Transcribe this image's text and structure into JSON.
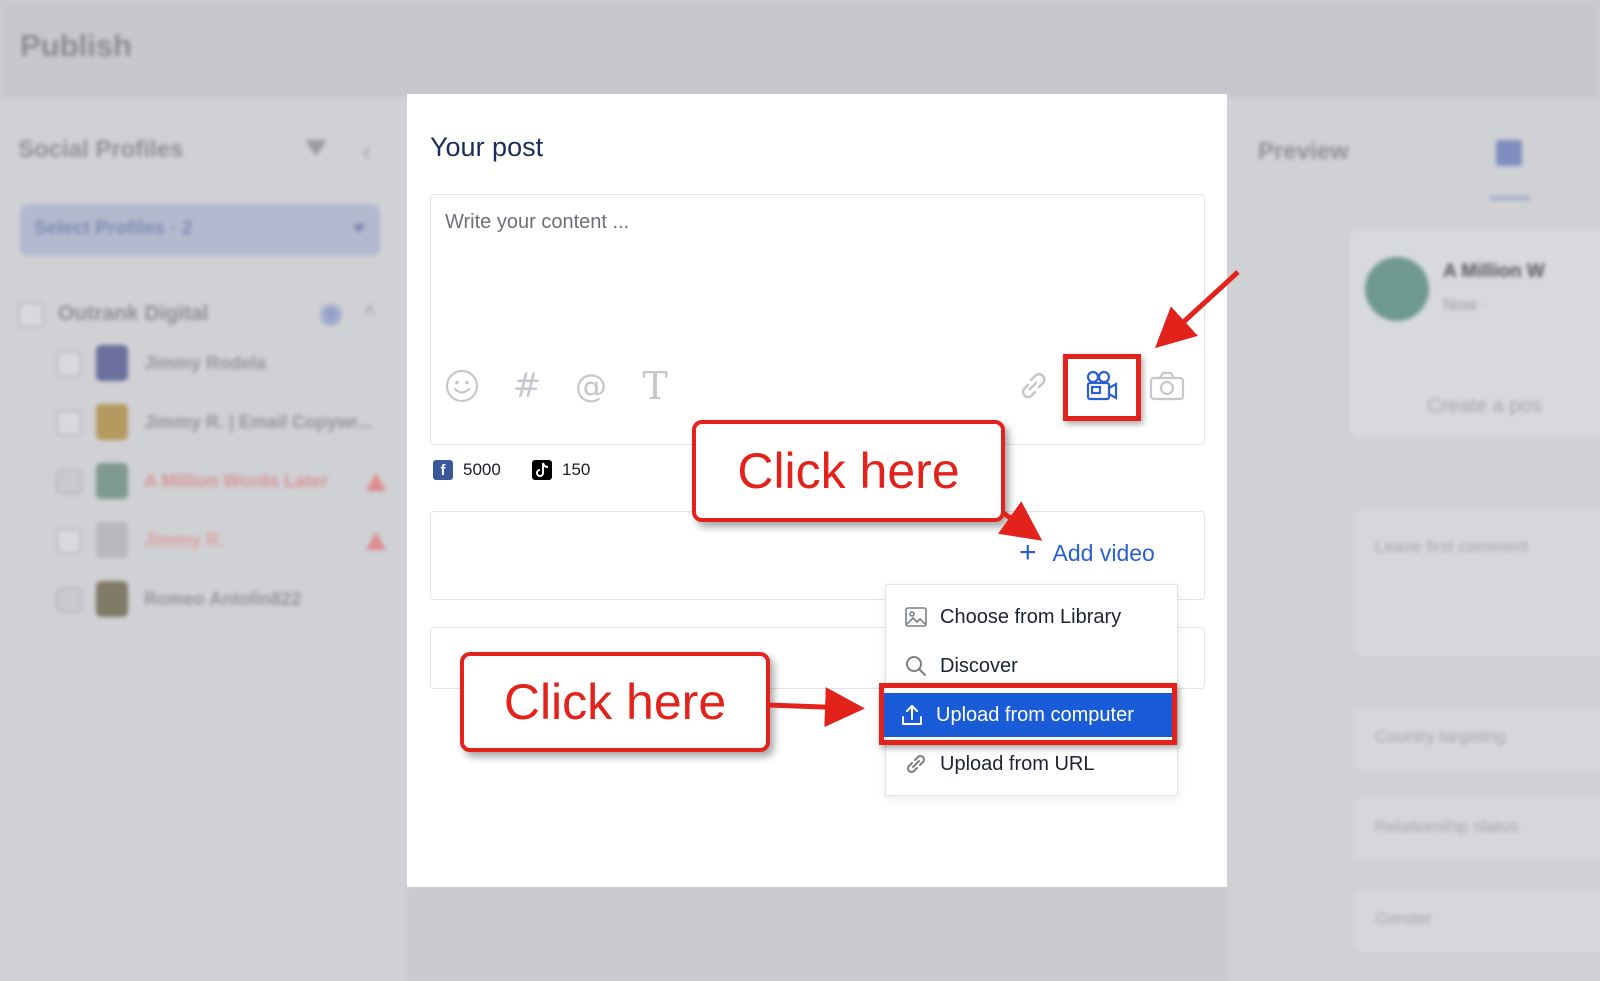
{
  "app": {
    "title": "Publish"
  },
  "sidebar": {
    "title": "Social Profiles",
    "select_label": "Select Profiles · 2",
    "group": {
      "label": "Outrank Digital",
      "badge": "5"
    },
    "profiles": [
      {
        "label": "Jimmy Rodela"
      },
      {
        "label": "Jimmy R. | Email Copywr..."
      },
      {
        "label": "A Million Words Later"
      },
      {
        "label": "Jimmy R."
      },
      {
        "label": "Romeo Antolin822"
      }
    ]
  },
  "preview": {
    "title": "Preview",
    "card_name": "A Million W",
    "card_time": "Now · ",
    "card_create": "Create a pos",
    "fields": [
      "Leave first comment",
      "Country targeting",
      "Relationship status",
      "Gender"
    ]
  },
  "modal": {
    "title": "Your post",
    "editor_placeholder": "Write your content ...",
    "tools": [
      "emoji-icon",
      "hashtag-icon",
      "mention-icon",
      "text-format-icon",
      "link-icon",
      "video-icon",
      "camera-icon"
    ],
    "counts": [
      {
        "network": "Facebook",
        "icon": "facebook-icon",
        "value": "5000",
        "color": "#3b5998"
      },
      {
        "network": "TikTok",
        "icon": "tiktok-icon",
        "value": "150",
        "color": "#000000"
      }
    ],
    "add_video_label": "Add video",
    "menu": [
      {
        "label": "Choose from Library",
        "icon": "image-icon"
      },
      {
        "label": "Discover",
        "icon": "search-icon"
      },
      {
        "label": "Upload from computer",
        "icon": "upload-icon",
        "active": true
      },
      {
        "label": "Upload from URL",
        "icon": "link-icon"
      }
    ]
  },
  "annotations": {
    "callout_1": "Click here",
    "callout_2": "Click here"
  },
  "colors": {
    "accent": "#1a5cd8",
    "annotation_red": "#e3231b",
    "title_navy": "#1a2b5c"
  }
}
